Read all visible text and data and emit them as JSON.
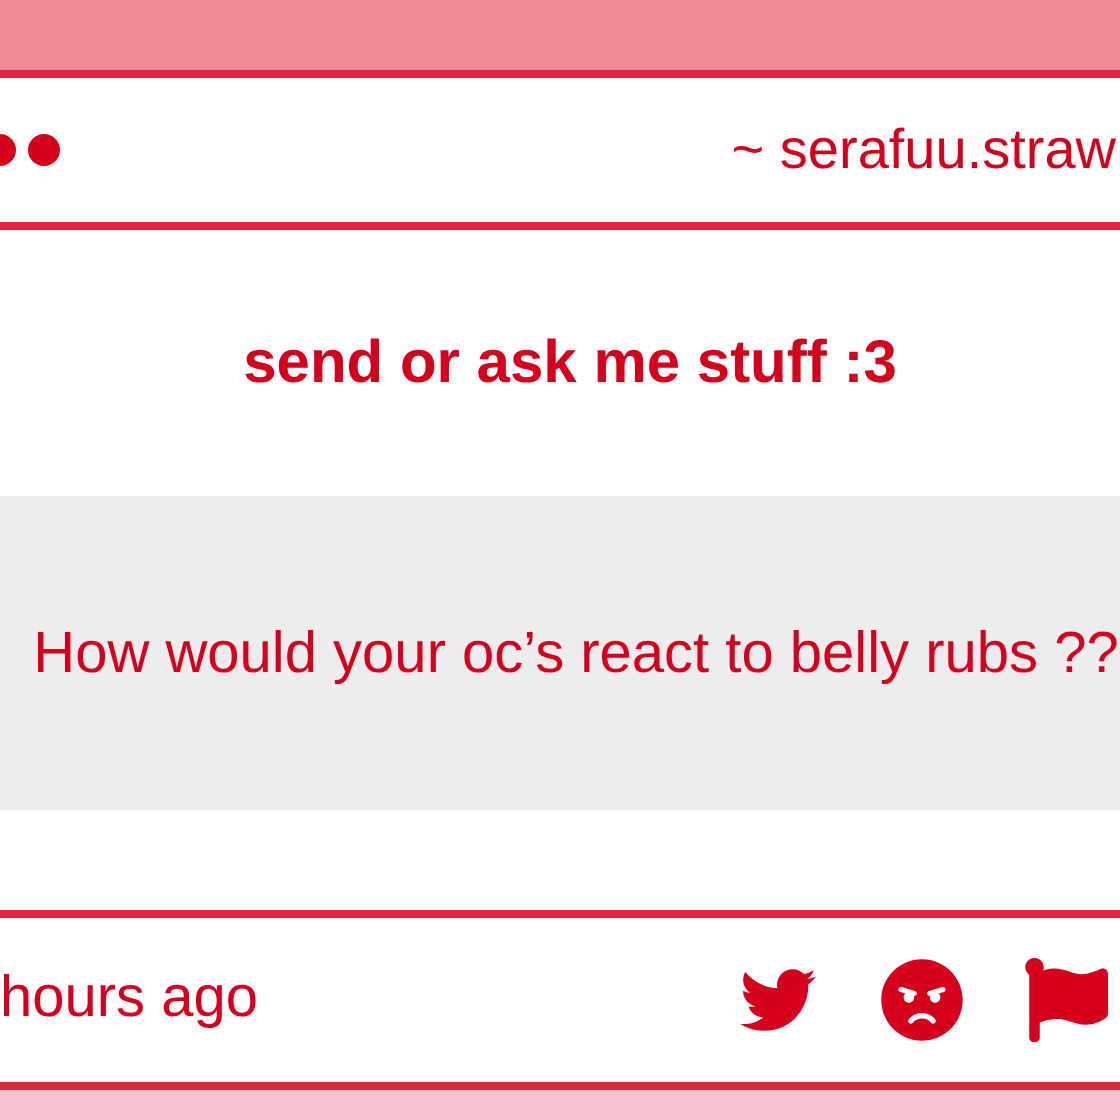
{
  "header": {
    "site": "~ serafuu.straw"
  },
  "title": "send or ask me stuff :3",
  "question": "How would your oc’s react to belly rubs ??",
  "footer": {
    "time": "hours ago"
  }
}
